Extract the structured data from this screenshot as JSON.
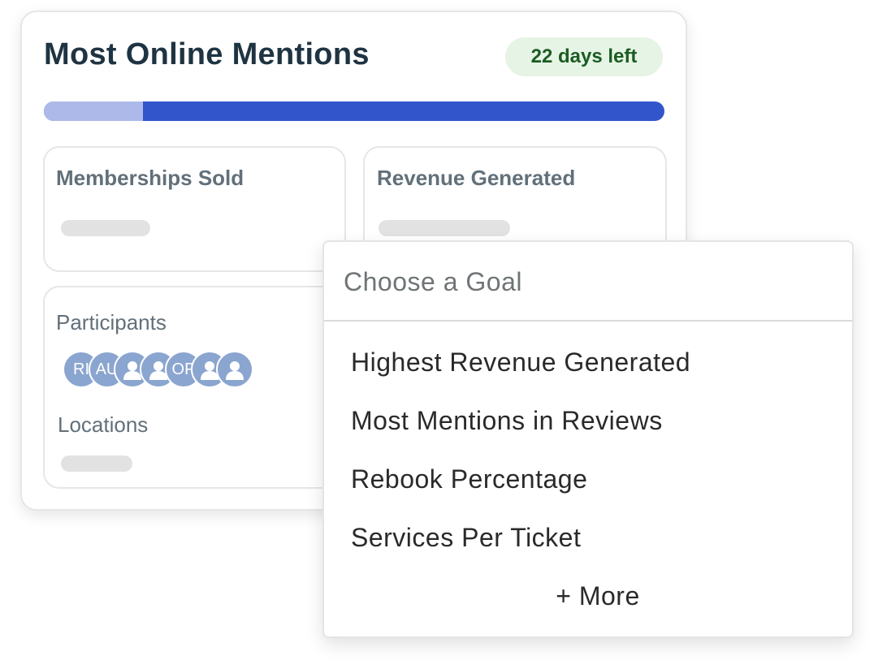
{
  "card": {
    "title": "Most Online Mentions",
    "days_left_label": "22 days left",
    "days_left_badge_bg": "#e6f4e6",
    "days_left_badge_text_color": "#1c5c22",
    "progress": {
      "elapsed_fraction": 0.16,
      "remaining_color": "#adb9e8",
      "elapsed_color": "#3355cc"
    }
  },
  "tiles": {
    "memberships": {
      "label": "Memberships Sold"
    },
    "revenue": {
      "label": "Revenue Generated"
    },
    "participants": {
      "label": "Participants",
      "avatars": [
        {
          "initials": "RI",
          "icon": ""
        },
        {
          "initials": "AU",
          "icon": ""
        },
        {
          "initials": "",
          "icon": "person-icon"
        },
        {
          "initials": "",
          "icon": "person-icon"
        },
        {
          "initials": "OP",
          "icon": ""
        },
        {
          "initials": "",
          "icon": "person-icon"
        },
        {
          "initials": "",
          "icon": "person-icon"
        }
      ],
      "avatar_color": "#8aa5cf"
    },
    "locations": {
      "label": "Locations"
    }
  },
  "dropdown": {
    "placeholder": "Choose a Goal",
    "options": [
      "Highest Revenue Generated",
      "Most Mentions in Reviews",
      "Rebook Percentage",
      "Services Per Ticket"
    ],
    "more_label": "+ More"
  }
}
